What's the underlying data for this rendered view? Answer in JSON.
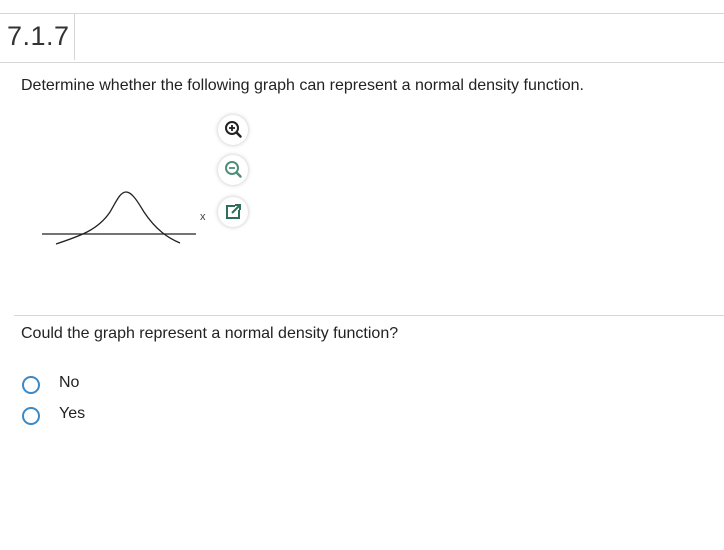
{
  "question": {
    "number": "7.1.7",
    "prompt": "Determine whether the following graph can represent a normal density function.",
    "subquestion": "Could the graph represent a normal density function?"
  },
  "graph": {
    "axis_label": "x"
  },
  "tools": {
    "zoom_in": "zoom-in-icon",
    "zoom_out": "zoom-out-icon",
    "popout": "popout-icon"
  },
  "options": [
    {
      "label": "No",
      "selected": false
    },
    {
      "label": "Yes",
      "selected": false
    }
  ],
  "colors": {
    "radio_border": "#3a89c9",
    "rule": "#d6d6d6"
  }
}
